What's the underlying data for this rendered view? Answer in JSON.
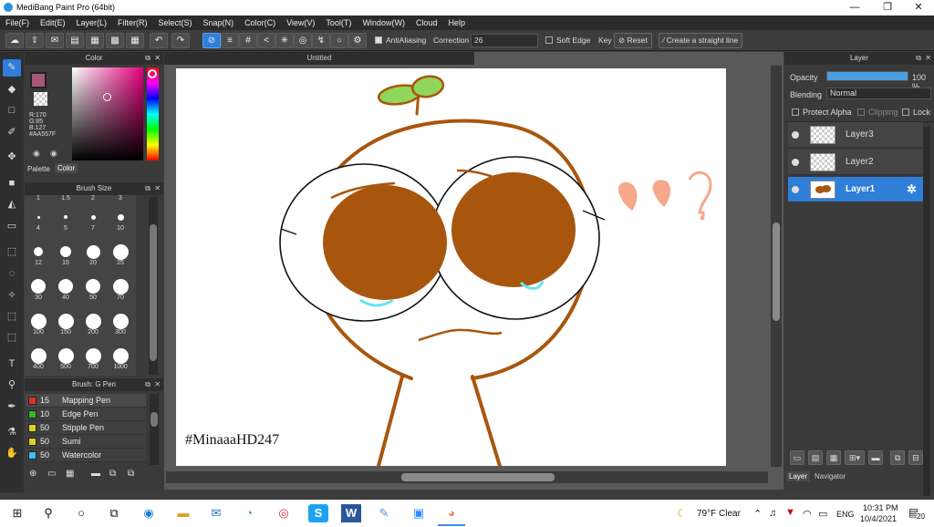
{
  "window": {
    "title": "MediBang Paint Pro (64bit)",
    "minimize": "—",
    "maximize": "❐",
    "close": "✕"
  },
  "menu": [
    "File(F)",
    "Edit(E)",
    "Layer(L)",
    "Filter(R)",
    "Select(S)",
    "Snap(N)",
    "Color(C)",
    "View(V)",
    "Tool(T)",
    "Window(W)",
    "Cloud",
    "Help"
  ],
  "toolbar": {
    "antialiasing_label": "AntiAliasing",
    "correction_label": "Correction",
    "correction_value": "26",
    "soft_edge_label": "Soft Edge",
    "key_label": "Key",
    "reset_label": "Reset",
    "straight_line_label": "Create a straight line"
  },
  "color_panel": {
    "title": "Color",
    "primary_color": "#AA557F",
    "r_label": "R:170",
    "g_label": "G:85",
    "b_label": "B:127",
    "hex_label": "#AA557F",
    "tabs": [
      "Palette",
      "Color"
    ]
  },
  "brush_size_panel": {
    "title": "Brush Size",
    "top_labels": [
      "1",
      "1.5",
      "2",
      "3"
    ],
    "sizes": [
      "4",
      "5",
      "7",
      "10",
      "12",
      "15",
      "20",
      "25",
      "30",
      "40",
      "50",
      "70",
      "100",
      "150",
      "200",
      "300",
      "400",
      "500",
      "700",
      "1000"
    ]
  },
  "brush_panel": {
    "title": "Brush: G Pen",
    "items": [
      {
        "size": "15",
        "name": "Mapping Pen",
        "color": "#e03030"
      },
      {
        "size": "10",
        "name": "Edge Pen",
        "color": "#2db82d"
      },
      {
        "size": "50",
        "name": "Stipple Pen",
        "color": "#e0d020"
      },
      {
        "size": "50",
        "name": "Sumi",
        "color": "#e0d020"
      },
      {
        "size": "50",
        "name": "Watercolor",
        "color": "#40c0f0"
      }
    ]
  },
  "document": {
    "tab_title": "Untitled",
    "signature": "#MinaaaHD247",
    "drawing_colors": {
      "outline": "#A8560E",
      "fill": "#A8560E",
      "tear": "#66E6F2",
      "sprout": "#8FD65A",
      "accent": "#F5A88A"
    }
  },
  "layer_panel": {
    "title": "Layer",
    "opacity_label": "Opacity",
    "opacity_value": "100 %",
    "opacity_fraction": 1.0,
    "blending_label": "Blending",
    "blending_value": "Normal",
    "protect_alpha_label": "Protect Alpha",
    "clipping_label": "Clipping",
    "lock_label": "Lock",
    "layers": [
      {
        "name": "Layer3",
        "selected": false
      },
      {
        "name": "Layer2",
        "selected": false
      },
      {
        "name": "Layer1",
        "selected": true
      }
    ],
    "bottom_tabs": [
      "Layer",
      "Navigator"
    ]
  },
  "taskbar": {
    "weather": "79°F  Clear",
    "lang": "ENG",
    "time": "10:31 PM",
    "date": "10/4/2021",
    "notification_count": "20"
  }
}
